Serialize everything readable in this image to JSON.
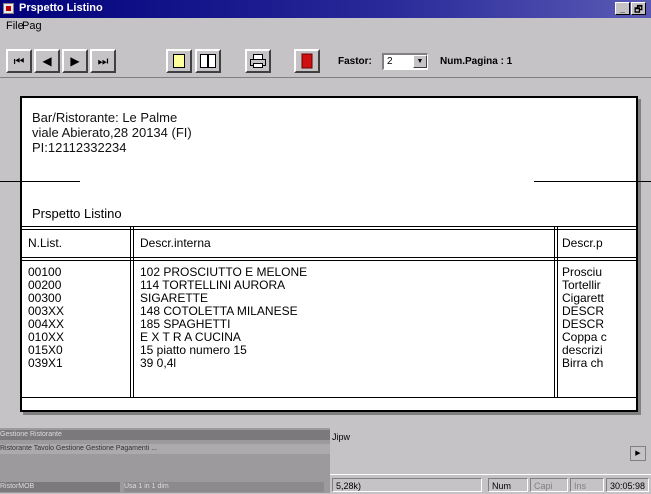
{
  "window": {
    "title": "Prspetto Listino",
    "controls": {
      "minimize": "_",
      "maximize": "🗗"
    }
  },
  "menu": {
    "items": [
      "File",
      "Pag"
    ]
  },
  "toolbar": {
    "buttons": {
      "first": "⏮",
      "prev": "◀",
      "next": "▶",
      "last": "⏭",
      "page_single": "page-icon",
      "page_double": "book-icon",
      "print": "printer-icon",
      "close": "exit-icon"
    },
    "zoom_label": "Fastor:",
    "zoom_value": "2",
    "zoom_arrow": "▼",
    "page_label": "Num.Pagina : 1"
  },
  "report": {
    "header_lines": [
      "Bar/Ristorante: Le Palme",
      "viale Abierato,28 20134 (FI)",
      "PI:12112332234"
    ],
    "section_title": "Prspetto Listino",
    "columns": [
      "N.List.",
      "Descr.interna",
      "Descr.p"
    ],
    "rows": [
      {
        "code": "00100",
        "internal": "102 PROSCIUTTO E MELONE",
        "public": "Prosciu"
      },
      {
        "code": "00200",
        "internal": "114 TORTELLINI AURORA",
        "public": "Tortellir"
      },
      {
        "code": "00300",
        "internal": "SIGARETTE",
        "public": "Cigarett"
      },
      {
        "code": "003XX",
        "internal": "148 COTOLETTA MILANESE",
        "public": "DESCR"
      },
      {
        "code": "004XX",
        "internal": "185 SPAGHETTI",
        "public": "DESCR"
      },
      {
        "code": "010XX",
        "internal": "E X T R A   CUCINA",
        "public": "Coppa c"
      },
      {
        "code": "015X0",
        "internal": "15 piatto numero 15",
        "public": "descrizi"
      },
      {
        "code": "039X1",
        "internal": "39 0,4l",
        "public": "Birra ch"
      }
    ]
  },
  "background": {
    "strip_labels": [
      "Gestione Ristorante",
      "Ristorante  Tavolo Gestione  Gestione  Pagamenti  ...",
      "RistorMOB",
      "Usa 1 in 1 dim"
    ],
    "right_label": "Jipw",
    "scroll_arrow": "▶",
    "status": [
      "5,28k)",
      "Num",
      "Capi",
      "Ins",
      "30:05:98"
    ]
  }
}
